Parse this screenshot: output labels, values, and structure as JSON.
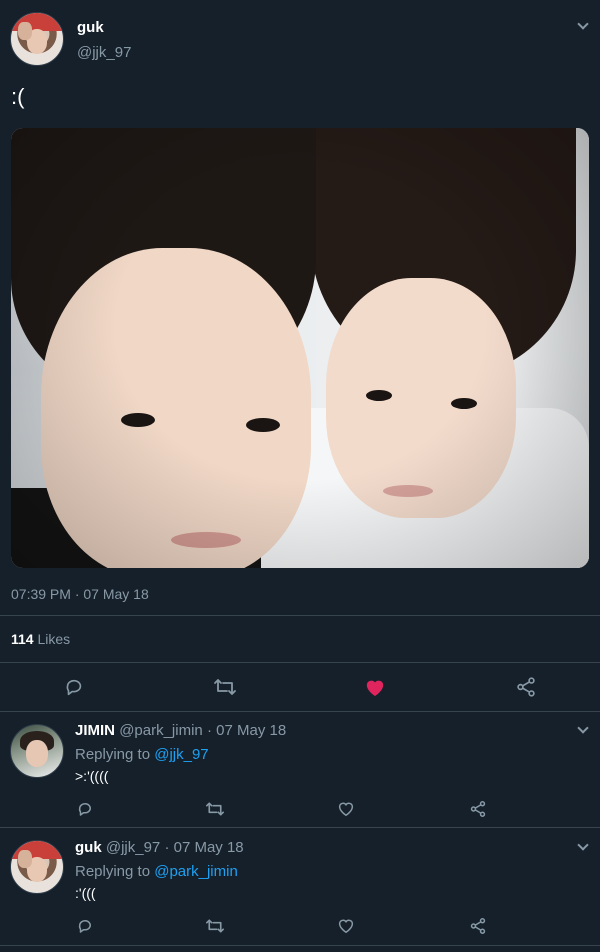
{
  "tweet": {
    "author_name": "guk",
    "author_handle": "@jjk_97",
    "text": ":(",
    "timestamp": "07:39 PM · 07 May 18",
    "likes_count": "114",
    "likes_label": "Likes",
    "actions": {
      "reply": "reply-icon",
      "retweet": "retweet-icon",
      "like": "heart-icon",
      "share": "share-icon"
    },
    "colors": {
      "background": "#15202b",
      "muted": "#8899a6",
      "link": "#1da1f2",
      "liked": "#e0245e",
      "divider": "#38444d"
    }
  },
  "replies": [
    {
      "name": "JIMIN",
      "handle": "@park_jimin",
      "date": "07 May 18",
      "replying_prefix": "Replying to",
      "replying_to": "@jjk_97",
      "text": ">:'(((("
    },
    {
      "name": "guk",
      "handle": "@jjk_97",
      "date": "07 May 18",
      "replying_prefix": "Replying to",
      "replying_to": "@park_jimin",
      "text": ":'((("
    }
  ]
}
